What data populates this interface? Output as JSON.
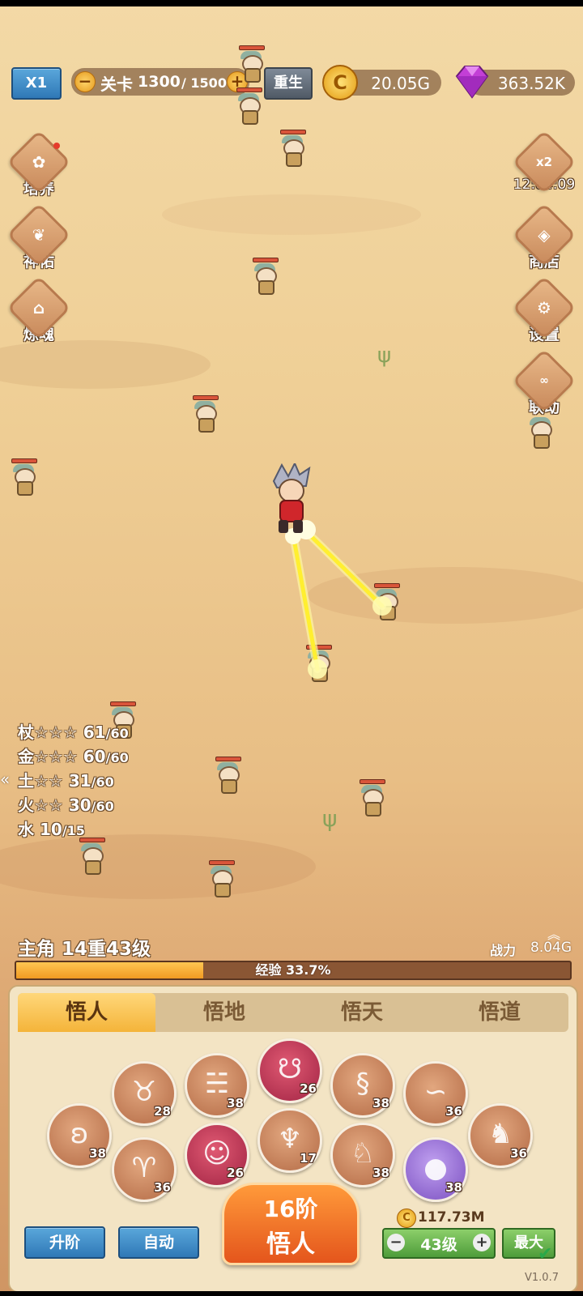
{
  "topbar": {
    "speed": "X1",
    "stage_label": "关卡",
    "stage_current": "1300",
    "stage_max": "/ 1500",
    "rebirth": "重生",
    "gold": "20.05G",
    "gems": "363.52K"
  },
  "left_menu": [
    {
      "label": "培养",
      "icon": "cultivate-icon"
    },
    {
      "label": "神佑",
      "icon": "blessing-icon"
    },
    {
      "label": "炼魂",
      "icon": "soul-refine-icon"
    }
  ],
  "right_menu": {
    "boost_badge": "x2",
    "boost_timer": "12:04:09",
    "items": [
      {
        "label": "商店",
        "icon": "shop-icon"
      },
      {
        "label": "设置",
        "icon": "settings-icon"
      },
      {
        "label": "联动",
        "icon": "link-icon"
      }
    ]
  },
  "stats": [
    {
      "name": "杖",
      "stars": "☆☆☆",
      "value": "61",
      "max": "/60"
    },
    {
      "name": "金",
      "stars": "☆☆☆",
      "value": "60",
      "max": "/60"
    },
    {
      "name": "土",
      "stars": "☆☆",
      "value": "31",
      "max": "/60"
    },
    {
      "name": "火",
      "stars": "☆☆",
      "value": "30",
      "max": "/60"
    },
    {
      "name": "水",
      "stars": "",
      "value": "10",
      "max": "/15"
    }
  ],
  "hero": {
    "title": "主角 14重43级",
    "power_label": "战力",
    "power_value": "8.04G",
    "exp_label": "经验 33.7%",
    "exp_fraction": 0.337
  },
  "tabs": [
    "悟人",
    "悟地",
    "悟天",
    "悟道"
  ],
  "zodiac": [
    {
      "name": "rat",
      "icon": "rat-icon",
      "level": "38",
      "style": "normal"
    },
    {
      "name": "ox",
      "icon": "ox-icon",
      "level": "28",
      "style": "normal"
    },
    {
      "name": "goat",
      "icon": "goat-icon",
      "level": "36",
      "style": "normal"
    },
    {
      "name": "tiger",
      "icon": "tiger-icon",
      "level": "38",
      "style": "normal"
    },
    {
      "name": "monkey",
      "icon": "monkey-icon",
      "level": "26",
      "style": "red"
    },
    {
      "name": "rabbit",
      "icon": "rabbit-icon",
      "level": "26",
      "style": "red"
    },
    {
      "name": "rooster",
      "icon": "rooster-icon",
      "level": "17",
      "style": "normal"
    },
    {
      "name": "dragon",
      "icon": "dragon-icon",
      "level": "38",
      "style": "normal"
    },
    {
      "name": "dog",
      "icon": "dog-icon",
      "level": "38",
      "style": "normal"
    },
    {
      "name": "snake",
      "icon": "snake-icon",
      "level": "36",
      "style": "normal"
    },
    {
      "name": "pig",
      "icon": "pig-icon",
      "level": "38",
      "style": "purple"
    },
    {
      "name": "horse",
      "icon": "horse-icon",
      "level": "36",
      "style": "normal"
    }
  ],
  "actions": {
    "upgrade": "升阶",
    "auto": "自动",
    "main_line1": "16阶",
    "main_line2": "悟人",
    "cost": "117.73M",
    "level": "43级",
    "max": "最大"
  },
  "version": "V1.0.7"
}
